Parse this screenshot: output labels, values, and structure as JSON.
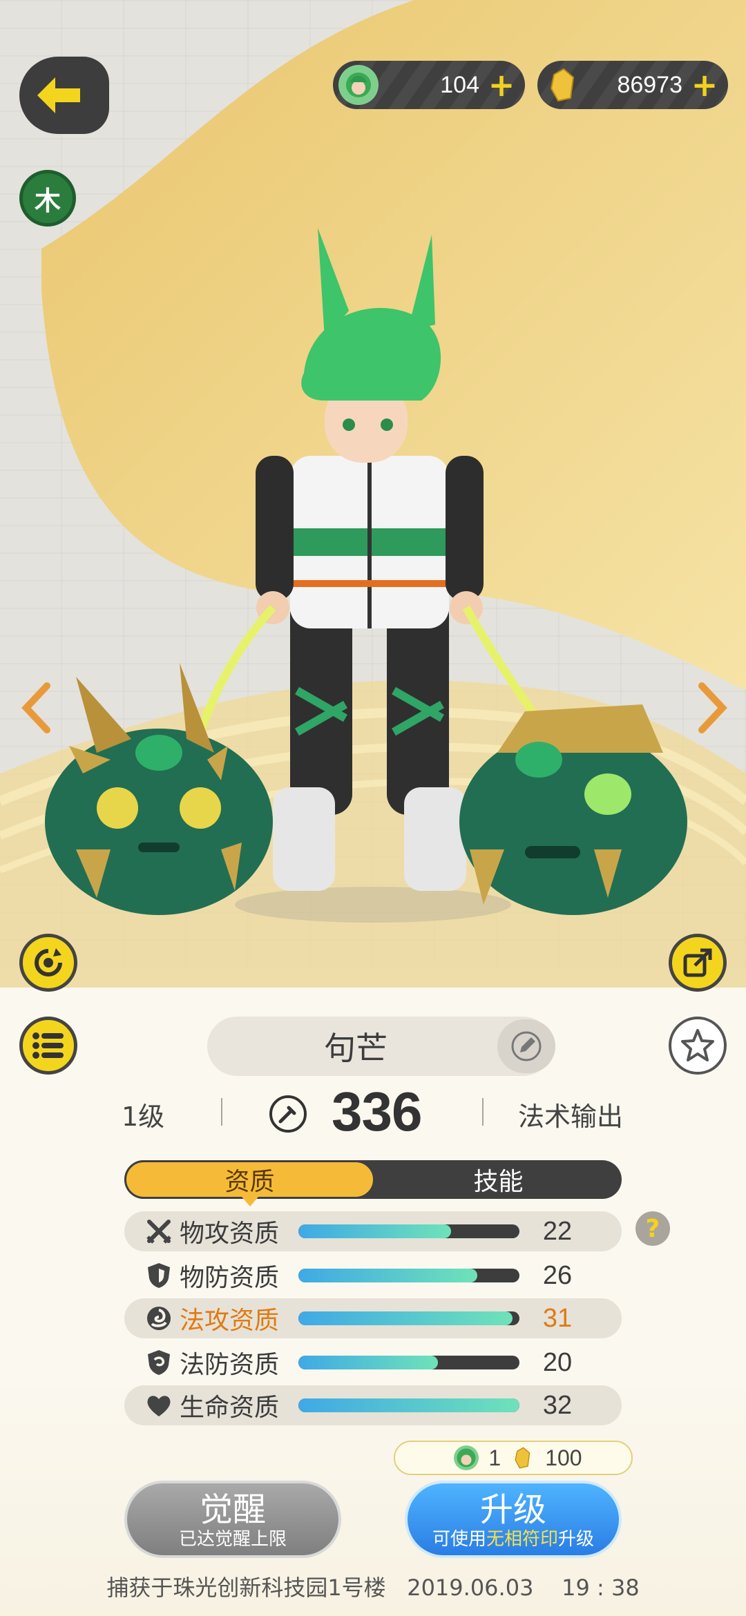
{
  "header": {
    "currency_spirit": {
      "value": "104",
      "icon": "green-spirit-icon"
    },
    "currency_crystal": {
      "value": "86973",
      "icon": "gold-crystal-icon"
    },
    "plus": "+"
  },
  "element": {
    "label": "木",
    "color": "#2a7d3d"
  },
  "monster": {
    "name": "句芒",
    "level": "1级",
    "power": "336",
    "role": "法术输出"
  },
  "tabs": [
    {
      "label": "资质",
      "active": true
    },
    {
      "label": "技能",
      "active": false
    }
  ],
  "attributes": [
    {
      "label": "物攻资质",
      "value": "22",
      "fill": 0.69,
      "icon": "crossed-swords-icon",
      "highlight": false
    },
    {
      "label": "物防资质",
      "value": "26",
      "fill": 0.81,
      "icon": "shield-icon",
      "highlight": false
    },
    {
      "label": "法攻资质",
      "value": "31",
      "fill": 0.97,
      "icon": "magic-swirl-icon",
      "highlight": true
    },
    {
      "label": "法防资质",
      "value": "20",
      "fill": 0.63,
      "icon": "magic-shield-icon",
      "highlight": false
    },
    {
      "label": "生命资质",
      "value": "32",
      "fill": 1.0,
      "icon": "heart-icon",
      "highlight": false
    }
  ],
  "help": "?",
  "cost": {
    "spirit": "1",
    "crystal": "100"
  },
  "buttons": {
    "awaken": {
      "label": "觉醒",
      "sub": "已达觉醒上限"
    },
    "upgrade": {
      "label": "升级",
      "sub_prefix": "可使用",
      "sub_accent": "无相符印",
      "sub_suffix": "升级"
    }
  },
  "footer": {
    "location": "捕获于珠光创新科技园1号楼",
    "date": "2019.06.03",
    "time": "19 : 38"
  },
  "colors": {
    "accent": "#f5bb38",
    "highlight": "#e07b12",
    "upgrade": "#2a7de4"
  }
}
